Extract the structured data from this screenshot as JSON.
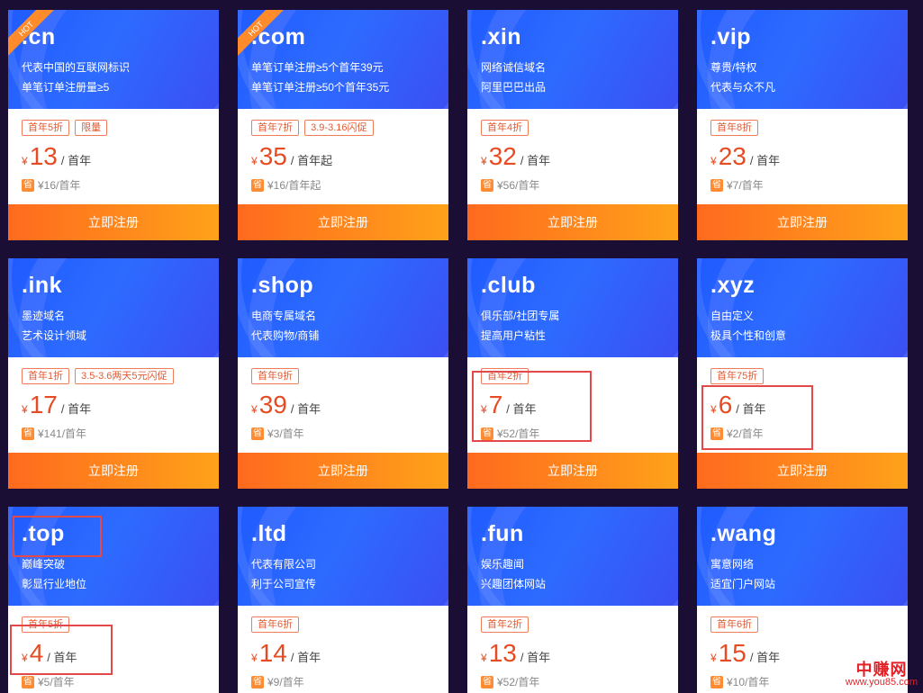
{
  "register_label": "立即注册",
  "hot_label": "HOT",
  "currency": "¥",
  "save_icon": "省",
  "cards": [
    {
      "ext": ".cn",
      "desc": [
        "代表中国的互联网标识",
        "单笔订单注册量≥5"
      ],
      "tags": [
        "首年5折",
        "限量"
      ],
      "price": "13",
      "unit": "/ 首年",
      "orig": "¥16/首年",
      "hot": true
    },
    {
      "ext": ".com",
      "desc": [
        "单笔订单注册≥5个首年39元",
        "单笔订单注册≥50个首年35元"
      ],
      "tags": [
        "首年7折",
        "3.9-3.16闪促"
      ],
      "price": "35",
      "unit": "/ 首年起",
      "orig": "¥16/首年起",
      "hot": true
    },
    {
      "ext": ".xin",
      "desc": [
        "网络诚信域名",
        "阿里巴巴出品"
      ],
      "tags": [
        "首年4折"
      ],
      "price": "32",
      "unit": "/ 首年",
      "orig": "¥56/首年",
      "hot": false
    },
    {
      "ext": ".vip",
      "desc": [
        "尊贵/特权",
        "代表与众不凡"
      ],
      "tags": [
        "首年8折"
      ],
      "price": "23",
      "unit": "/ 首年",
      "orig": "¥7/首年",
      "hot": false
    },
    {
      "ext": ".ink",
      "desc": [
        "墨迹域名",
        "艺术设计领域"
      ],
      "tags": [
        "首年1折",
        "3.5-3.6两天5元闪促"
      ],
      "price": "17",
      "unit": "/ 首年",
      "orig": "¥141/首年",
      "hot": false
    },
    {
      "ext": ".shop",
      "desc": [
        "电商专属域名",
        "代表购物/商铺"
      ],
      "tags": [
        "首年9折"
      ],
      "price": "39",
      "unit": "/ 首年",
      "orig": "¥3/首年",
      "hot": false
    },
    {
      "ext": ".club",
      "desc": [
        "俱乐部/社团专属",
        "提高用户粘性"
      ],
      "tags": [
        "首年2折"
      ],
      "price": "7",
      "unit": "/ 首年",
      "orig": "¥52/首年",
      "hot": false
    },
    {
      "ext": ".xyz",
      "desc": [
        "自由定义",
        "极具个性和创意"
      ],
      "tags": [
        "首年75折"
      ],
      "price": "6",
      "unit": "/ 首年",
      "orig": "¥2/首年",
      "hot": false
    },
    {
      "ext": ".top",
      "desc": [
        "巅峰突破",
        "彰显行业地位"
      ],
      "tags": [
        "首年5折"
      ],
      "price": "4",
      "unit": "/ 首年",
      "orig": "¥5/首年",
      "hot": false
    },
    {
      "ext": ".ltd",
      "desc": [
        "代表有限公司",
        "利于公司宣传"
      ],
      "tags": [
        "首年6折"
      ],
      "price": "14",
      "unit": "/ 首年",
      "orig": "¥9/首年",
      "hot": false
    },
    {
      "ext": ".fun",
      "desc": [
        "娱乐趣闻",
        "兴趣团体网站"
      ],
      "tags": [
        "首年2折"
      ],
      "price": "13",
      "unit": "/ 首年",
      "orig": "¥52/首年",
      "hot": false
    },
    {
      "ext": ".wang",
      "desc": [
        "寓意网络",
        "适宜门户网站"
      ],
      "tags": [
        "首年6折"
      ],
      "price": "15",
      "unit": "/ 首年",
      "orig": "¥10/首年",
      "hot": false
    }
  ],
  "watermark": {
    "line1": "中赚网",
    "line2": "www.you85.com"
  },
  "colors": {
    "background": "#1b0e34",
    "header_blue": "#2d6bff",
    "accent_orange": "#ff8c1a",
    "price_red": "#e64b24",
    "highlight_red": "#e54848"
  }
}
